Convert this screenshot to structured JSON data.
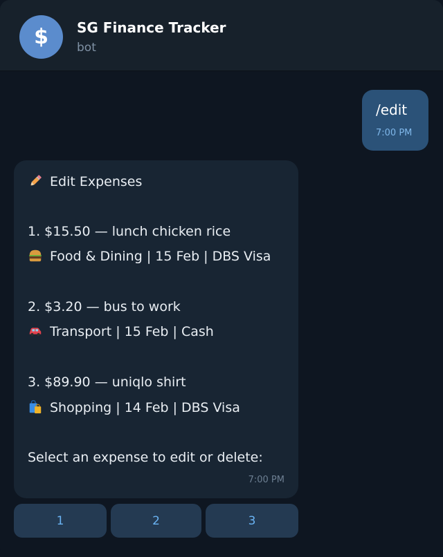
{
  "header": {
    "avatar_glyph": "$",
    "title": "SG Finance Tracker",
    "subtitle": "bot"
  },
  "outgoing": {
    "text": "/edit",
    "time": "7:00 PM"
  },
  "incoming": {
    "heading": "Edit Expenses",
    "heading_icon": "pencil-icon",
    "expenses": [
      {
        "line": "1. $15.50 — lunch chicken rice",
        "detail": "Food & Dining | 15 Feb | DBS Visa",
        "icon": "burger-icon"
      },
      {
        "line": "2. $3.20 — bus to work",
        "detail": "Transport | 15 Feb | Cash",
        "icon": "car-icon"
      },
      {
        "line": "3. $89.90 — uniqlo shirt",
        "detail": "Shopping | 14 Feb | DBS Visa",
        "icon": "shopping-bags-icon"
      }
    ],
    "prompt": "Select an expense to edit or delete:",
    "time": "7:00 PM"
  },
  "keyboard": {
    "buttons": [
      "1",
      "2",
      "3"
    ]
  },
  "colors": {
    "background": "#0e1621",
    "header": "#17212b",
    "outgoing_bubble": "#2b5278",
    "incoming_bubble": "#182533",
    "keyboard_button": "#243a52",
    "accent": "#6ab3f3"
  }
}
